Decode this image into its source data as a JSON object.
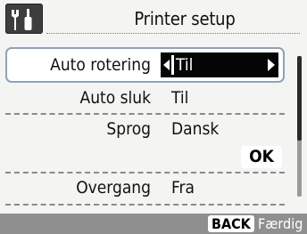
{
  "header": {
    "tab_icon": "settings-tools-icon",
    "title": "Printer setup"
  },
  "settings": [
    {
      "label": "Auto rotering",
      "value": "Til",
      "selected": true
    },
    {
      "label": "Auto sluk",
      "value": "Til"
    },
    {
      "label": "Sprog",
      "value": "Dansk"
    },
    {
      "label": "Overgang",
      "value": "Fra"
    }
  ],
  "ok_label": "OK",
  "footer": {
    "back_key": "BACK",
    "back_label": "Færdig"
  },
  "colors": {
    "highlight": "#050505",
    "selection_border": "#8ea3b8",
    "footer_bg": "#8f8f8f"
  }
}
